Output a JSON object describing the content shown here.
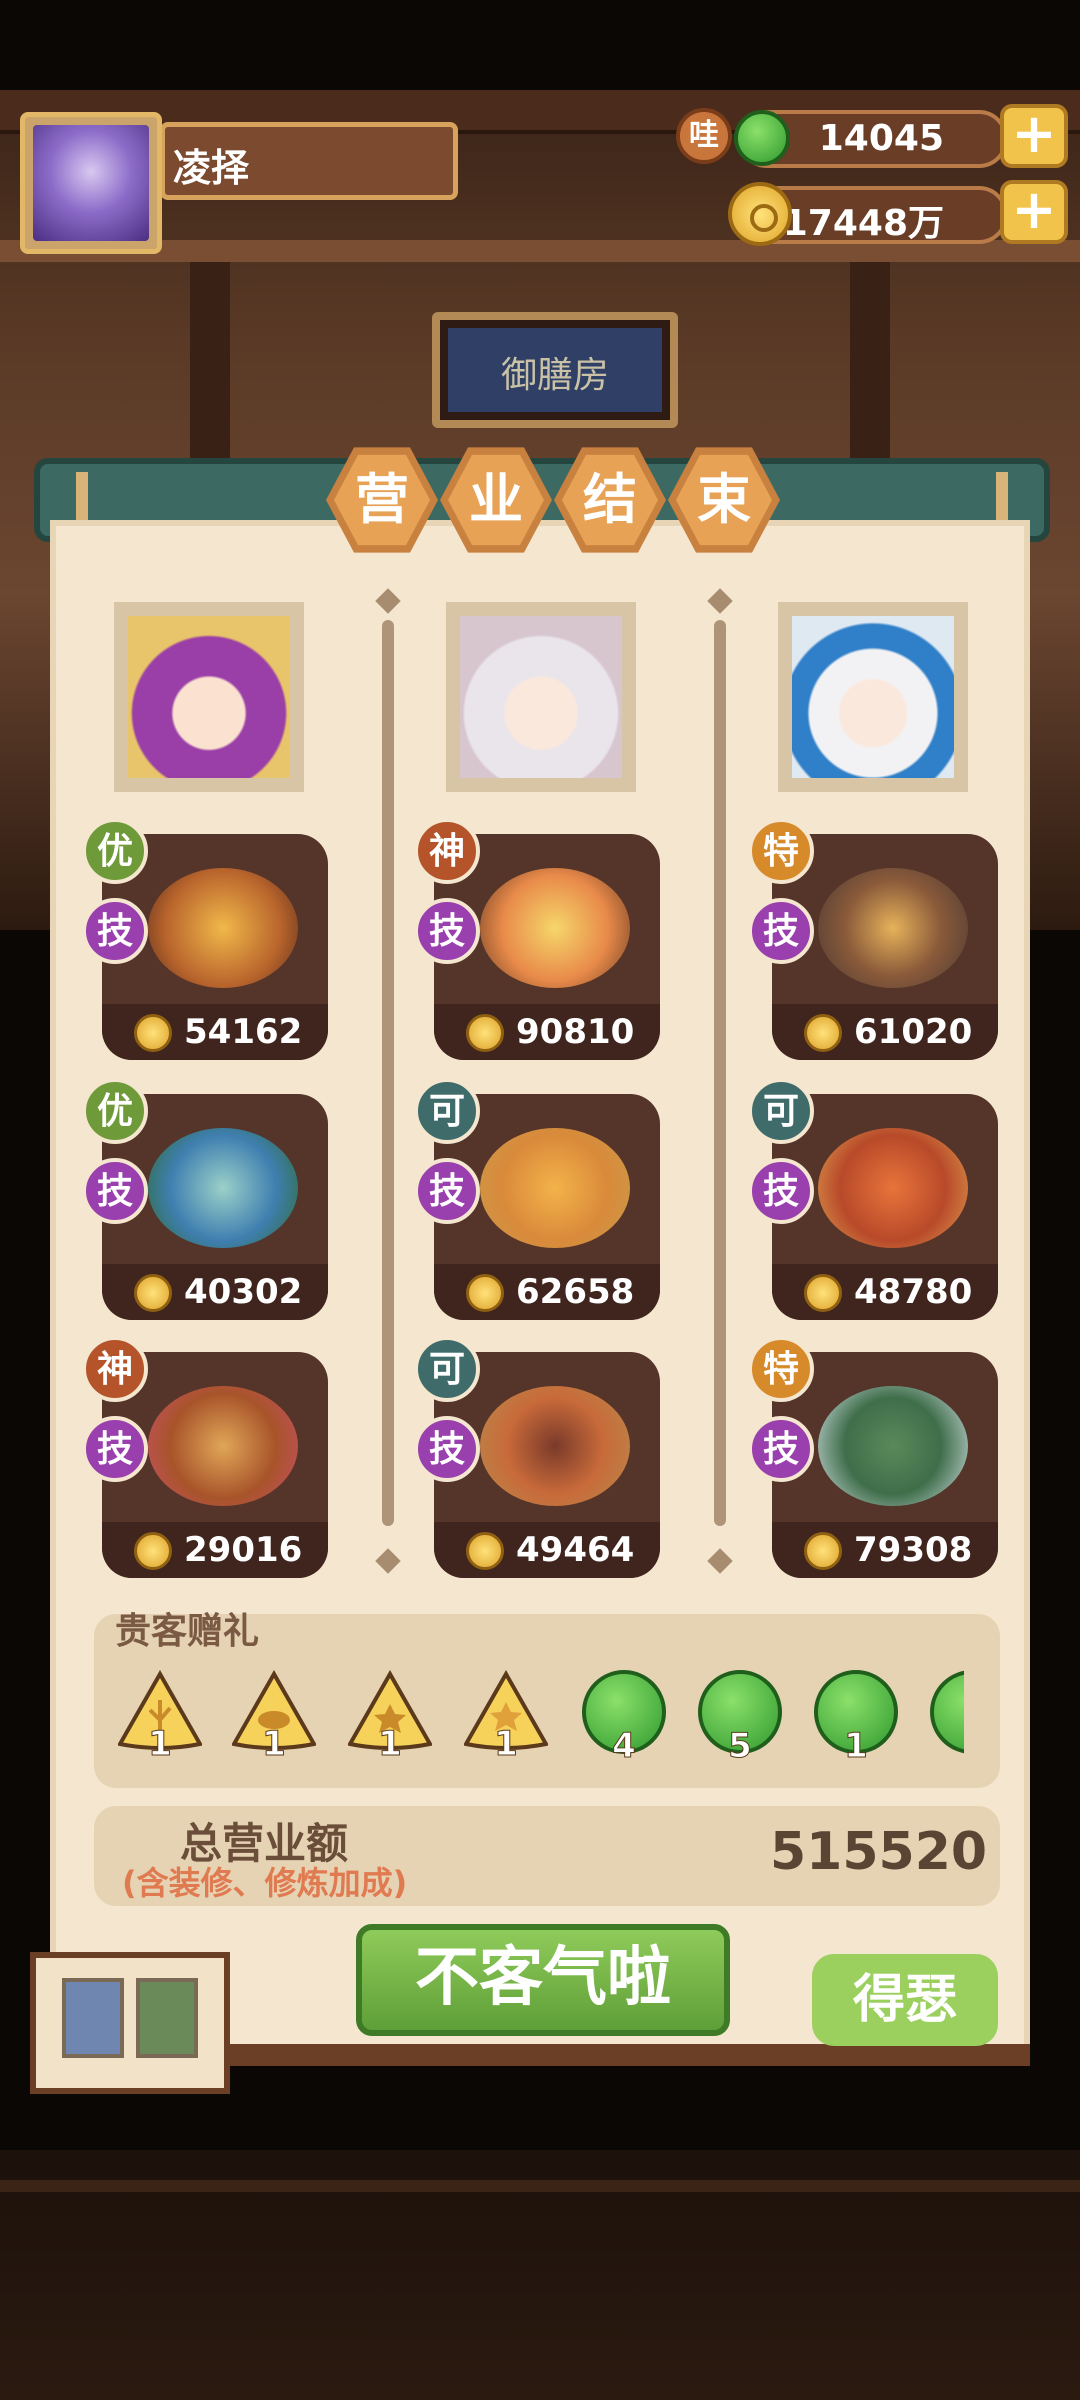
{
  "player": {
    "name": "凌择"
  },
  "resources": [
    {
      "name": "wa",
      "label": "哇",
      "value": "14045"
    },
    {
      "name": "coin",
      "value": "17448万"
    }
  ],
  "background": {
    "sign_text": "御膳房"
  },
  "panel": {
    "title_chars": [
      "营",
      "业",
      "结",
      "束"
    ],
    "columns": [
      {
        "dishes": [
          {
            "grade": "优",
            "skill": "技",
            "income": "54162"
          },
          {
            "grade": "优",
            "skill": "技",
            "income": "40302"
          },
          {
            "grade": "神",
            "skill": "技",
            "income": "29016"
          }
        ]
      },
      {
        "dishes": [
          {
            "grade": "神",
            "skill": "技",
            "income": "90810"
          },
          {
            "grade": "可",
            "skill": "技",
            "income": "62658"
          },
          {
            "grade": "可",
            "skill": "技",
            "income": "49464"
          }
        ]
      },
      {
        "dishes": [
          {
            "grade": "特",
            "skill": "技",
            "income": "61020"
          },
          {
            "grade": "可",
            "skill": "技",
            "income": "48780"
          },
          {
            "grade": "特",
            "skill": "技",
            "income": "79308"
          }
        ]
      }
    ],
    "gifts": {
      "title": "贵客赠礼",
      "items": [
        {
          "icon": "coral-chip-icon",
          "count": "1"
        },
        {
          "icon": "fish-chip-icon",
          "count": "1"
        },
        {
          "icon": "star-chip-icon",
          "count": "1"
        },
        {
          "icon": "starfish-chip-icon",
          "count": "1"
        },
        {
          "icon": "jade-icon",
          "count": "4"
        },
        {
          "icon": "jade-icon",
          "count": "5"
        },
        {
          "icon": "jade-icon",
          "count": "1"
        }
      ]
    },
    "total": {
      "label": "总营业额",
      "note": "(含装修、修炼加成)",
      "value": "515520"
    },
    "buttons": {
      "main": "不客气啦",
      "side": "得瑟"
    }
  },
  "colors": {
    "accent_green": "#6aa83e",
    "banner_teal": "#3c6a63",
    "panel_bg": "#f4e6cf",
    "card_bg": "#55342a"
  }
}
